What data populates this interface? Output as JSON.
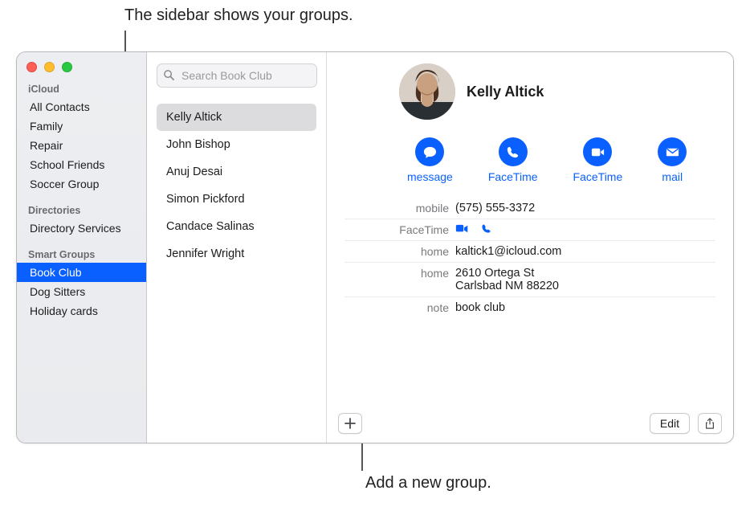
{
  "callouts": {
    "top": "The sidebar shows your groups.",
    "bottom": "Add a new group."
  },
  "sidebar": {
    "sections": [
      {
        "header": "iCloud",
        "items": [
          {
            "label": "All Contacts",
            "selected": false
          },
          {
            "label": "Family",
            "selected": false
          },
          {
            "label": "Repair",
            "selected": false
          },
          {
            "label": "School Friends",
            "selected": false
          },
          {
            "label": "Soccer Group",
            "selected": false
          }
        ]
      },
      {
        "header": "Directories",
        "items": [
          {
            "label": "Directory Services",
            "selected": false
          }
        ]
      },
      {
        "header": "Smart Groups",
        "items": [
          {
            "label": "Book Club",
            "selected": true
          },
          {
            "label": "Dog Sitters",
            "selected": false
          },
          {
            "label": "Holiday cards",
            "selected": false
          }
        ]
      }
    ]
  },
  "search": {
    "placeholder": "Search Book Club"
  },
  "contacts": [
    {
      "name": "Kelly Altick",
      "selected": true
    },
    {
      "name": "John Bishop",
      "selected": false
    },
    {
      "name": "Anuj Desai",
      "selected": false
    },
    {
      "name": "Simon Pickford",
      "selected": false
    },
    {
      "name": "Candace Salinas",
      "selected": false
    },
    {
      "name": "Jennifer Wright",
      "selected": false
    }
  ],
  "detail": {
    "name": "Kelly Altick",
    "actions": [
      {
        "icon": "message-icon",
        "label": "message"
      },
      {
        "icon": "phone-icon",
        "label": "FaceTime"
      },
      {
        "icon": "video-icon",
        "label": "FaceTime"
      },
      {
        "icon": "mail-icon",
        "label": "mail"
      }
    ],
    "fields": [
      {
        "label": "mobile",
        "value": "(575) 555-3372",
        "type": "text"
      },
      {
        "label": "FaceTime",
        "type": "facetime-icons"
      },
      {
        "label": "home",
        "value": "kaltick1@icloud.com",
        "type": "text"
      },
      {
        "label": "home",
        "value": "2610 Ortega St\nCarlsbad NM 88220",
        "type": "multiline"
      },
      {
        "label": "note",
        "value": "book club",
        "type": "text"
      }
    ]
  },
  "buttons": {
    "edit": "Edit"
  },
  "colors": {
    "accent": "#0a60ff"
  }
}
